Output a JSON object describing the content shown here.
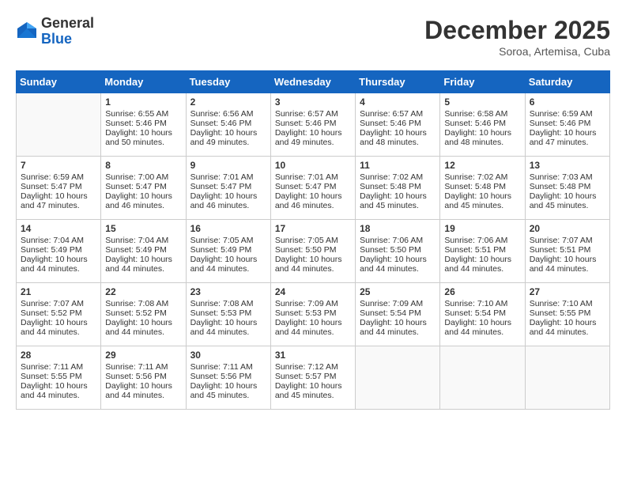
{
  "header": {
    "logo_general": "General",
    "logo_blue": "Blue",
    "month_title": "December 2025",
    "subtitle": "Soroa, Artemisa, Cuba"
  },
  "days_of_week": [
    "Sunday",
    "Monday",
    "Tuesday",
    "Wednesday",
    "Thursday",
    "Friday",
    "Saturday"
  ],
  "weeks": [
    [
      {
        "day": "",
        "content": ""
      },
      {
        "day": "1",
        "content": "Sunrise: 6:55 AM\nSunset: 5:46 PM\nDaylight: 10 hours\nand 50 minutes."
      },
      {
        "day": "2",
        "content": "Sunrise: 6:56 AM\nSunset: 5:46 PM\nDaylight: 10 hours\nand 49 minutes."
      },
      {
        "day": "3",
        "content": "Sunrise: 6:57 AM\nSunset: 5:46 PM\nDaylight: 10 hours\nand 49 minutes."
      },
      {
        "day": "4",
        "content": "Sunrise: 6:57 AM\nSunset: 5:46 PM\nDaylight: 10 hours\nand 48 minutes."
      },
      {
        "day": "5",
        "content": "Sunrise: 6:58 AM\nSunset: 5:46 PM\nDaylight: 10 hours\nand 48 minutes."
      },
      {
        "day": "6",
        "content": "Sunrise: 6:59 AM\nSunset: 5:46 PM\nDaylight: 10 hours\nand 47 minutes."
      }
    ],
    [
      {
        "day": "7",
        "content": "Sunrise: 6:59 AM\nSunset: 5:47 PM\nDaylight: 10 hours\nand 47 minutes."
      },
      {
        "day": "8",
        "content": "Sunrise: 7:00 AM\nSunset: 5:47 PM\nDaylight: 10 hours\nand 46 minutes."
      },
      {
        "day": "9",
        "content": "Sunrise: 7:01 AM\nSunset: 5:47 PM\nDaylight: 10 hours\nand 46 minutes."
      },
      {
        "day": "10",
        "content": "Sunrise: 7:01 AM\nSunset: 5:47 PM\nDaylight: 10 hours\nand 46 minutes."
      },
      {
        "day": "11",
        "content": "Sunrise: 7:02 AM\nSunset: 5:48 PM\nDaylight: 10 hours\nand 45 minutes."
      },
      {
        "day": "12",
        "content": "Sunrise: 7:02 AM\nSunset: 5:48 PM\nDaylight: 10 hours\nand 45 minutes."
      },
      {
        "day": "13",
        "content": "Sunrise: 7:03 AM\nSunset: 5:48 PM\nDaylight: 10 hours\nand 45 minutes."
      }
    ],
    [
      {
        "day": "14",
        "content": "Sunrise: 7:04 AM\nSunset: 5:49 PM\nDaylight: 10 hours\nand 44 minutes."
      },
      {
        "day": "15",
        "content": "Sunrise: 7:04 AM\nSunset: 5:49 PM\nDaylight: 10 hours\nand 44 minutes."
      },
      {
        "day": "16",
        "content": "Sunrise: 7:05 AM\nSunset: 5:49 PM\nDaylight: 10 hours\nand 44 minutes."
      },
      {
        "day": "17",
        "content": "Sunrise: 7:05 AM\nSunset: 5:50 PM\nDaylight: 10 hours\nand 44 minutes."
      },
      {
        "day": "18",
        "content": "Sunrise: 7:06 AM\nSunset: 5:50 PM\nDaylight: 10 hours\nand 44 minutes."
      },
      {
        "day": "19",
        "content": "Sunrise: 7:06 AM\nSunset: 5:51 PM\nDaylight: 10 hours\nand 44 minutes."
      },
      {
        "day": "20",
        "content": "Sunrise: 7:07 AM\nSunset: 5:51 PM\nDaylight: 10 hours\nand 44 minutes."
      }
    ],
    [
      {
        "day": "21",
        "content": "Sunrise: 7:07 AM\nSunset: 5:52 PM\nDaylight: 10 hours\nand 44 minutes."
      },
      {
        "day": "22",
        "content": "Sunrise: 7:08 AM\nSunset: 5:52 PM\nDaylight: 10 hours\nand 44 minutes."
      },
      {
        "day": "23",
        "content": "Sunrise: 7:08 AM\nSunset: 5:53 PM\nDaylight: 10 hours\nand 44 minutes."
      },
      {
        "day": "24",
        "content": "Sunrise: 7:09 AM\nSunset: 5:53 PM\nDaylight: 10 hours\nand 44 minutes."
      },
      {
        "day": "25",
        "content": "Sunrise: 7:09 AM\nSunset: 5:54 PM\nDaylight: 10 hours\nand 44 minutes."
      },
      {
        "day": "26",
        "content": "Sunrise: 7:10 AM\nSunset: 5:54 PM\nDaylight: 10 hours\nand 44 minutes."
      },
      {
        "day": "27",
        "content": "Sunrise: 7:10 AM\nSunset: 5:55 PM\nDaylight: 10 hours\nand 44 minutes."
      }
    ],
    [
      {
        "day": "28",
        "content": "Sunrise: 7:11 AM\nSunset: 5:55 PM\nDaylight: 10 hours\nand 44 minutes."
      },
      {
        "day": "29",
        "content": "Sunrise: 7:11 AM\nSunset: 5:56 PM\nDaylight: 10 hours\nand 44 minutes."
      },
      {
        "day": "30",
        "content": "Sunrise: 7:11 AM\nSunset: 5:56 PM\nDaylight: 10 hours\nand 45 minutes."
      },
      {
        "day": "31",
        "content": "Sunrise: 7:12 AM\nSunset: 5:57 PM\nDaylight: 10 hours\nand 45 minutes."
      },
      {
        "day": "",
        "content": ""
      },
      {
        "day": "",
        "content": ""
      },
      {
        "day": "",
        "content": ""
      }
    ]
  ]
}
